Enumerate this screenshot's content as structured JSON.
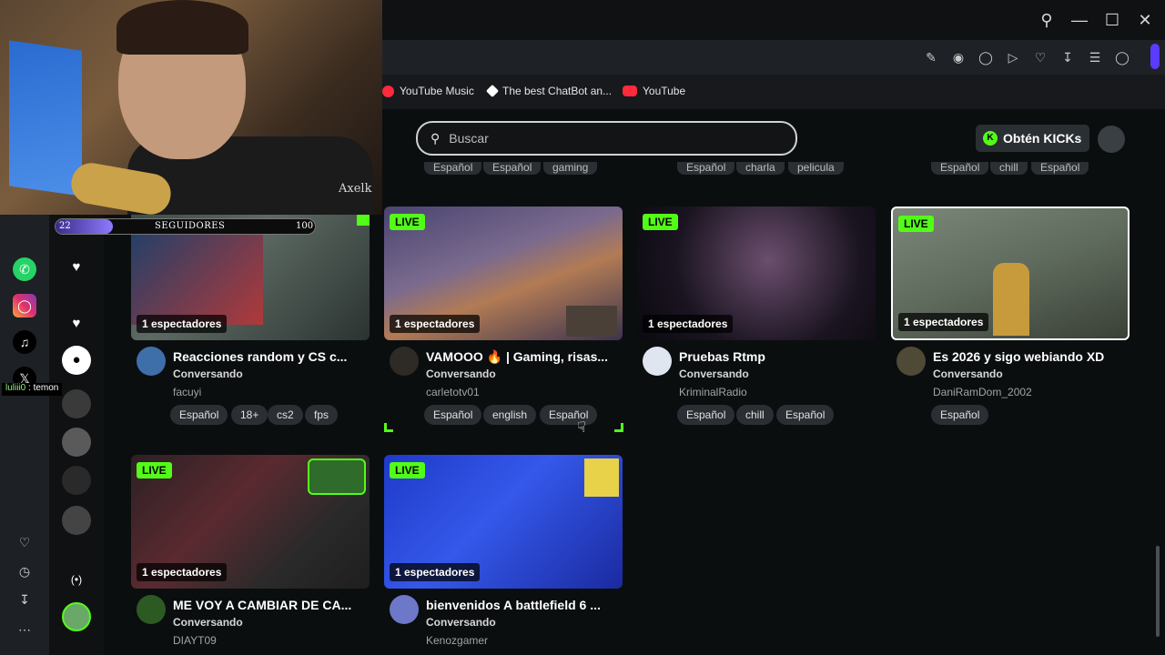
{
  "bookmarks": [
    {
      "label": "YouTube Music",
      "icon": "youtube-music-icon",
      "color": "#ff2a3b"
    },
    {
      "label": "The best ChatBot an...",
      "icon": "chatbot-icon",
      "color": "#ffffff"
    },
    {
      "label": "YouTube",
      "icon": "youtube-icon",
      "color": "#ff2a3b"
    }
  ],
  "search": {
    "placeholder": "Buscar"
  },
  "kicks_button": {
    "label": "Obtén KICKs",
    "accent": "#53fc18"
  },
  "prev_row_tags": [
    [
      "Español",
      "Español",
      "gaming"
    ],
    [
      "Español",
      "charla",
      "pelicula"
    ],
    [
      "Español",
      "chill",
      "Español"
    ]
  ],
  "streams": [
    {
      "title": "Reacciones random y CS c...",
      "category": "Conversando",
      "user": "facuyi",
      "viewers": "1 espectadores",
      "live": "LIVE",
      "tags": [
        "Español",
        "18+",
        "cs2",
        "fps"
      ]
    },
    {
      "title": "VAMOOO 🔥 | Gaming, risas...",
      "category": "Conversando",
      "user": "carletotv01",
      "viewers": "1 espectadores",
      "live": "LIVE",
      "tags": [
        "Español",
        "english",
        "Español"
      ]
    },
    {
      "title": "Pruebas Rtmp",
      "category": "Conversando",
      "user": "KriminalRadio",
      "viewers": "1 espectadores",
      "live": "LIVE",
      "tags": [
        "Español",
        "chill",
        "Español"
      ]
    },
    {
      "title": "Es 2026 y sigo webiando XD",
      "category": "Conversando",
      "user": "DaniRamDom_2002",
      "viewers": "1 espectadores",
      "live": "LIVE",
      "tags": [
        "Español"
      ]
    },
    {
      "title": "ME VOY A CAMBIAR DE CA...",
      "category": "Conversando",
      "user": "DIAYT09",
      "viewers": "1 espectadores",
      "live": "LIVE",
      "tags": []
    },
    {
      "title": "bienvenidos A battlefield 6 ...",
      "category": "Conversando",
      "user": "Kenozgamer",
      "viewers": "1 espectadores",
      "live": "LIVE",
      "tags": []
    }
  ],
  "overlay": {
    "watermark": "Axelk",
    "followers_label": "SEGUIDORES",
    "followers_current": "22",
    "followers_goal": "100",
    "followers_progress": 0.22,
    "chat_user": "luliii0",
    "chat_message": ": temon"
  },
  "rail_icons": [
    "whatsapp-icon",
    "instagram-icon",
    "tiktok-icon",
    "x-icon",
    "heart-icon",
    "clock-icon",
    "download-icon",
    "more-icon"
  ],
  "colors": {
    "live_green": "#53fc18",
    "background": "#0b0e0f"
  }
}
